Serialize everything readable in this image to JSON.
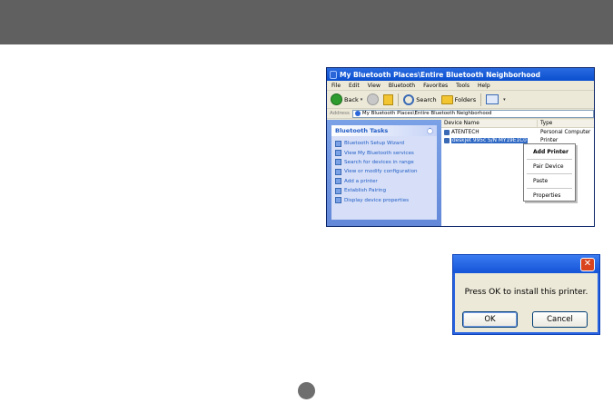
{
  "explorer": {
    "title": "My Bluetooth Places\\Entire Bluetooth Neighborhood",
    "menu": [
      "File",
      "Edit",
      "View",
      "Bluetooth",
      "Favorites",
      "Tools",
      "Help"
    ],
    "toolbar": {
      "back": "Back",
      "search": "Search",
      "folders": "Folders"
    },
    "address": {
      "label": "Address",
      "value": "My Bluetooth Places\\Entire Bluetooth Neighborhood"
    },
    "tasks": {
      "header": "Bluetooth Tasks",
      "items": [
        "Bluetooth Setup Wizard",
        "View My Bluetooth services",
        "Search for devices in range",
        "View or modify configuration",
        "Add a printer",
        "Establish Pairing",
        "Display device properties"
      ]
    },
    "list": {
      "col_name": "Device Name",
      "col_type": "Type",
      "rows": [
        {
          "name": "ATENTECH",
          "type": "Personal Computer"
        },
        {
          "name": "deskjet 995c S/N MY19E1C0",
          "type": "Printer"
        }
      ]
    },
    "context_menu": [
      "Add Printer",
      "Pair Device",
      "Paste",
      "Properties"
    ]
  },
  "dialog": {
    "message": "Press OK to install this printer.",
    "ok": "OK",
    "cancel": "Cancel"
  },
  "colors": {
    "topbar": "#606060",
    "xp_blue": "#215dc6",
    "page_dot": "#6e6e6e"
  }
}
